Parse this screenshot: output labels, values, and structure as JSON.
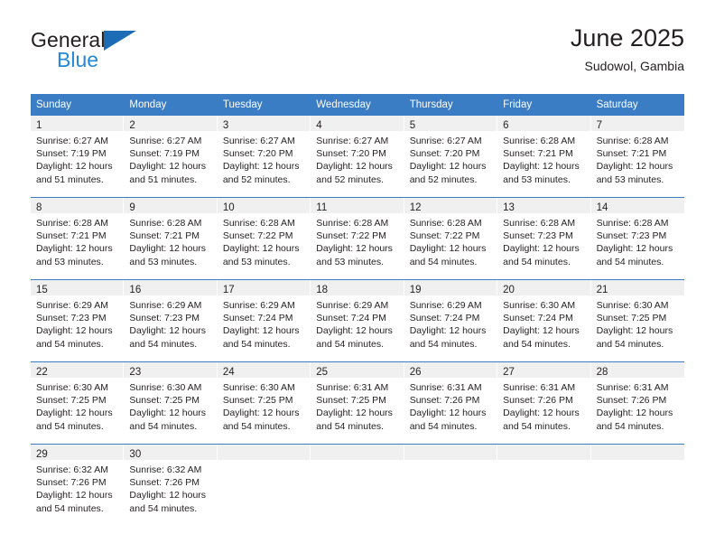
{
  "brand": {
    "name_top": "General",
    "name_bottom": "Blue",
    "triangle_color": "#1b6cb5",
    "blue_text_color": "#2388d6"
  },
  "header": {
    "title": "June 2025",
    "subtitle": "Sudowol, Gambia"
  },
  "theme": {
    "header_bg": "#3b7dc4",
    "header_text": "#ffffff",
    "daynum_band_bg": "#f0f0f0",
    "text": "#231f20",
    "row_divider": "#3b7dc4"
  },
  "weekdays": [
    "Sunday",
    "Monday",
    "Tuesday",
    "Wednesday",
    "Thursday",
    "Friday",
    "Saturday"
  ],
  "weeks": [
    [
      {
        "day": "1",
        "sunrise": "Sunrise: 6:27 AM",
        "sunset": "Sunset: 7:19 PM",
        "daylight1": "Daylight: 12 hours",
        "daylight2": "and 51 minutes."
      },
      {
        "day": "2",
        "sunrise": "Sunrise: 6:27 AM",
        "sunset": "Sunset: 7:19 PM",
        "daylight1": "Daylight: 12 hours",
        "daylight2": "and 51 minutes."
      },
      {
        "day": "3",
        "sunrise": "Sunrise: 6:27 AM",
        "sunset": "Sunset: 7:20 PM",
        "daylight1": "Daylight: 12 hours",
        "daylight2": "and 52 minutes."
      },
      {
        "day": "4",
        "sunrise": "Sunrise: 6:27 AM",
        "sunset": "Sunset: 7:20 PM",
        "daylight1": "Daylight: 12 hours",
        "daylight2": "and 52 minutes."
      },
      {
        "day": "5",
        "sunrise": "Sunrise: 6:27 AM",
        "sunset": "Sunset: 7:20 PM",
        "daylight1": "Daylight: 12 hours",
        "daylight2": "and 52 minutes."
      },
      {
        "day": "6",
        "sunrise": "Sunrise: 6:28 AM",
        "sunset": "Sunset: 7:21 PM",
        "daylight1": "Daylight: 12 hours",
        "daylight2": "and 53 minutes."
      },
      {
        "day": "7",
        "sunrise": "Sunrise: 6:28 AM",
        "sunset": "Sunset: 7:21 PM",
        "daylight1": "Daylight: 12 hours",
        "daylight2": "and 53 minutes."
      }
    ],
    [
      {
        "day": "8",
        "sunrise": "Sunrise: 6:28 AM",
        "sunset": "Sunset: 7:21 PM",
        "daylight1": "Daylight: 12 hours",
        "daylight2": "and 53 minutes."
      },
      {
        "day": "9",
        "sunrise": "Sunrise: 6:28 AM",
        "sunset": "Sunset: 7:21 PM",
        "daylight1": "Daylight: 12 hours",
        "daylight2": "and 53 minutes."
      },
      {
        "day": "10",
        "sunrise": "Sunrise: 6:28 AM",
        "sunset": "Sunset: 7:22 PM",
        "daylight1": "Daylight: 12 hours",
        "daylight2": "and 53 minutes."
      },
      {
        "day": "11",
        "sunrise": "Sunrise: 6:28 AM",
        "sunset": "Sunset: 7:22 PM",
        "daylight1": "Daylight: 12 hours",
        "daylight2": "and 53 minutes."
      },
      {
        "day": "12",
        "sunrise": "Sunrise: 6:28 AM",
        "sunset": "Sunset: 7:22 PM",
        "daylight1": "Daylight: 12 hours",
        "daylight2": "and 54 minutes."
      },
      {
        "day": "13",
        "sunrise": "Sunrise: 6:28 AM",
        "sunset": "Sunset: 7:23 PM",
        "daylight1": "Daylight: 12 hours",
        "daylight2": "and 54 minutes."
      },
      {
        "day": "14",
        "sunrise": "Sunrise: 6:28 AM",
        "sunset": "Sunset: 7:23 PM",
        "daylight1": "Daylight: 12 hours",
        "daylight2": "and 54 minutes."
      }
    ],
    [
      {
        "day": "15",
        "sunrise": "Sunrise: 6:29 AM",
        "sunset": "Sunset: 7:23 PM",
        "daylight1": "Daylight: 12 hours",
        "daylight2": "and 54 minutes."
      },
      {
        "day": "16",
        "sunrise": "Sunrise: 6:29 AM",
        "sunset": "Sunset: 7:23 PM",
        "daylight1": "Daylight: 12 hours",
        "daylight2": "and 54 minutes."
      },
      {
        "day": "17",
        "sunrise": "Sunrise: 6:29 AM",
        "sunset": "Sunset: 7:24 PM",
        "daylight1": "Daylight: 12 hours",
        "daylight2": "and 54 minutes."
      },
      {
        "day": "18",
        "sunrise": "Sunrise: 6:29 AM",
        "sunset": "Sunset: 7:24 PM",
        "daylight1": "Daylight: 12 hours",
        "daylight2": "and 54 minutes."
      },
      {
        "day": "19",
        "sunrise": "Sunrise: 6:29 AM",
        "sunset": "Sunset: 7:24 PM",
        "daylight1": "Daylight: 12 hours",
        "daylight2": "and 54 minutes."
      },
      {
        "day": "20",
        "sunrise": "Sunrise: 6:30 AM",
        "sunset": "Sunset: 7:24 PM",
        "daylight1": "Daylight: 12 hours",
        "daylight2": "and 54 minutes."
      },
      {
        "day": "21",
        "sunrise": "Sunrise: 6:30 AM",
        "sunset": "Sunset: 7:25 PM",
        "daylight1": "Daylight: 12 hours",
        "daylight2": "and 54 minutes."
      }
    ],
    [
      {
        "day": "22",
        "sunrise": "Sunrise: 6:30 AM",
        "sunset": "Sunset: 7:25 PM",
        "daylight1": "Daylight: 12 hours",
        "daylight2": "and 54 minutes."
      },
      {
        "day": "23",
        "sunrise": "Sunrise: 6:30 AM",
        "sunset": "Sunset: 7:25 PM",
        "daylight1": "Daylight: 12 hours",
        "daylight2": "and 54 minutes."
      },
      {
        "day": "24",
        "sunrise": "Sunrise: 6:30 AM",
        "sunset": "Sunset: 7:25 PM",
        "daylight1": "Daylight: 12 hours",
        "daylight2": "and 54 minutes."
      },
      {
        "day": "25",
        "sunrise": "Sunrise: 6:31 AM",
        "sunset": "Sunset: 7:25 PM",
        "daylight1": "Daylight: 12 hours",
        "daylight2": "and 54 minutes."
      },
      {
        "day": "26",
        "sunrise": "Sunrise: 6:31 AM",
        "sunset": "Sunset: 7:26 PM",
        "daylight1": "Daylight: 12 hours",
        "daylight2": "and 54 minutes."
      },
      {
        "day": "27",
        "sunrise": "Sunrise: 6:31 AM",
        "sunset": "Sunset: 7:26 PM",
        "daylight1": "Daylight: 12 hours",
        "daylight2": "and 54 minutes."
      },
      {
        "day": "28",
        "sunrise": "Sunrise: 6:31 AM",
        "sunset": "Sunset: 7:26 PM",
        "daylight1": "Daylight: 12 hours",
        "daylight2": "and 54 minutes."
      }
    ],
    [
      {
        "day": "29",
        "sunrise": "Sunrise: 6:32 AM",
        "sunset": "Sunset: 7:26 PM",
        "daylight1": "Daylight: 12 hours",
        "daylight2": "and 54 minutes."
      },
      {
        "day": "30",
        "sunrise": "Sunrise: 6:32 AM",
        "sunset": "Sunset: 7:26 PM",
        "daylight1": "Daylight: 12 hours",
        "daylight2": "and 54 minutes."
      },
      {
        "day": "",
        "sunrise": "",
        "sunset": "",
        "daylight1": "",
        "daylight2": ""
      },
      {
        "day": "",
        "sunrise": "",
        "sunset": "",
        "daylight1": "",
        "daylight2": ""
      },
      {
        "day": "",
        "sunrise": "",
        "sunset": "",
        "daylight1": "",
        "daylight2": ""
      },
      {
        "day": "",
        "sunrise": "",
        "sunset": "",
        "daylight1": "",
        "daylight2": ""
      },
      {
        "day": "",
        "sunrise": "",
        "sunset": "",
        "daylight1": "",
        "daylight2": ""
      }
    ]
  ]
}
